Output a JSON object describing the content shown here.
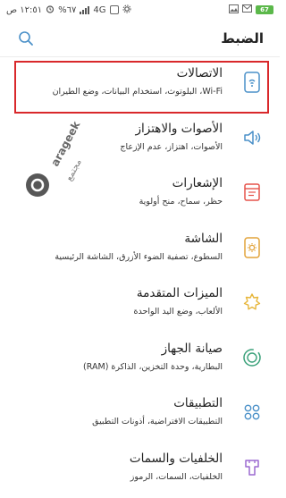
{
  "status": {
    "time": "١٢:٥١ ص",
    "battery": "67",
    "network": "4G",
    "percent": "%٦٧"
  },
  "header": {
    "title": "الضبط"
  },
  "items": [
    {
      "label": "الاتصالات",
      "sub": "Wi-Fi، البلوتوث، استخدام البيانات، وضع الطيران",
      "icon": "connections-icon"
    },
    {
      "label": "الأصوات والاهتزاز",
      "sub": "الأصوات، اهتزاز، عدم الإزعاج",
      "icon": "sound-icon"
    },
    {
      "label": "الإشعارات",
      "sub": "حظر، سماح، منح أولوية",
      "icon": "notifications-icon"
    },
    {
      "label": "الشاشة",
      "sub": "السطوع، تصفية الضوء الأزرق، الشاشة الرئيسية",
      "icon": "display-icon"
    },
    {
      "label": "الميزات المتقدمة",
      "sub": "الألعاب، وضع اليد الواحدة",
      "icon": "advanced-features-icon"
    },
    {
      "label": "صيانة الجهاز",
      "sub": "البطارية، وحدة التخزين، الذاكرة (RAM)",
      "icon": "device-maintenance-icon"
    },
    {
      "label": "التطبيقات",
      "sub": "التطبيقات الافتراضية، أذونات التطبيق",
      "icon": "apps-icon"
    },
    {
      "label": "الخلفيات والسمات",
      "sub": "الخلفيات، السمات، الرموز",
      "icon": "wallpapers-themes-icon"
    }
  ],
  "watermark": {
    "brand": "arageek",
    "arabic": "مجتمع"
  },
  "colors": {
    "accent": "#4a90c8",
    "highlight_border": "#d9282b",
    "notif_accent": "#e5534b",
    "display_accent": "#e2a33a",
    "advanced_accent": "#e7b63a",
    "maintenance_accent": "#3aa17a",
    "apps_accent": "#4a90c8",
    "themes_accent": "#9c6ad0"
  }
}
